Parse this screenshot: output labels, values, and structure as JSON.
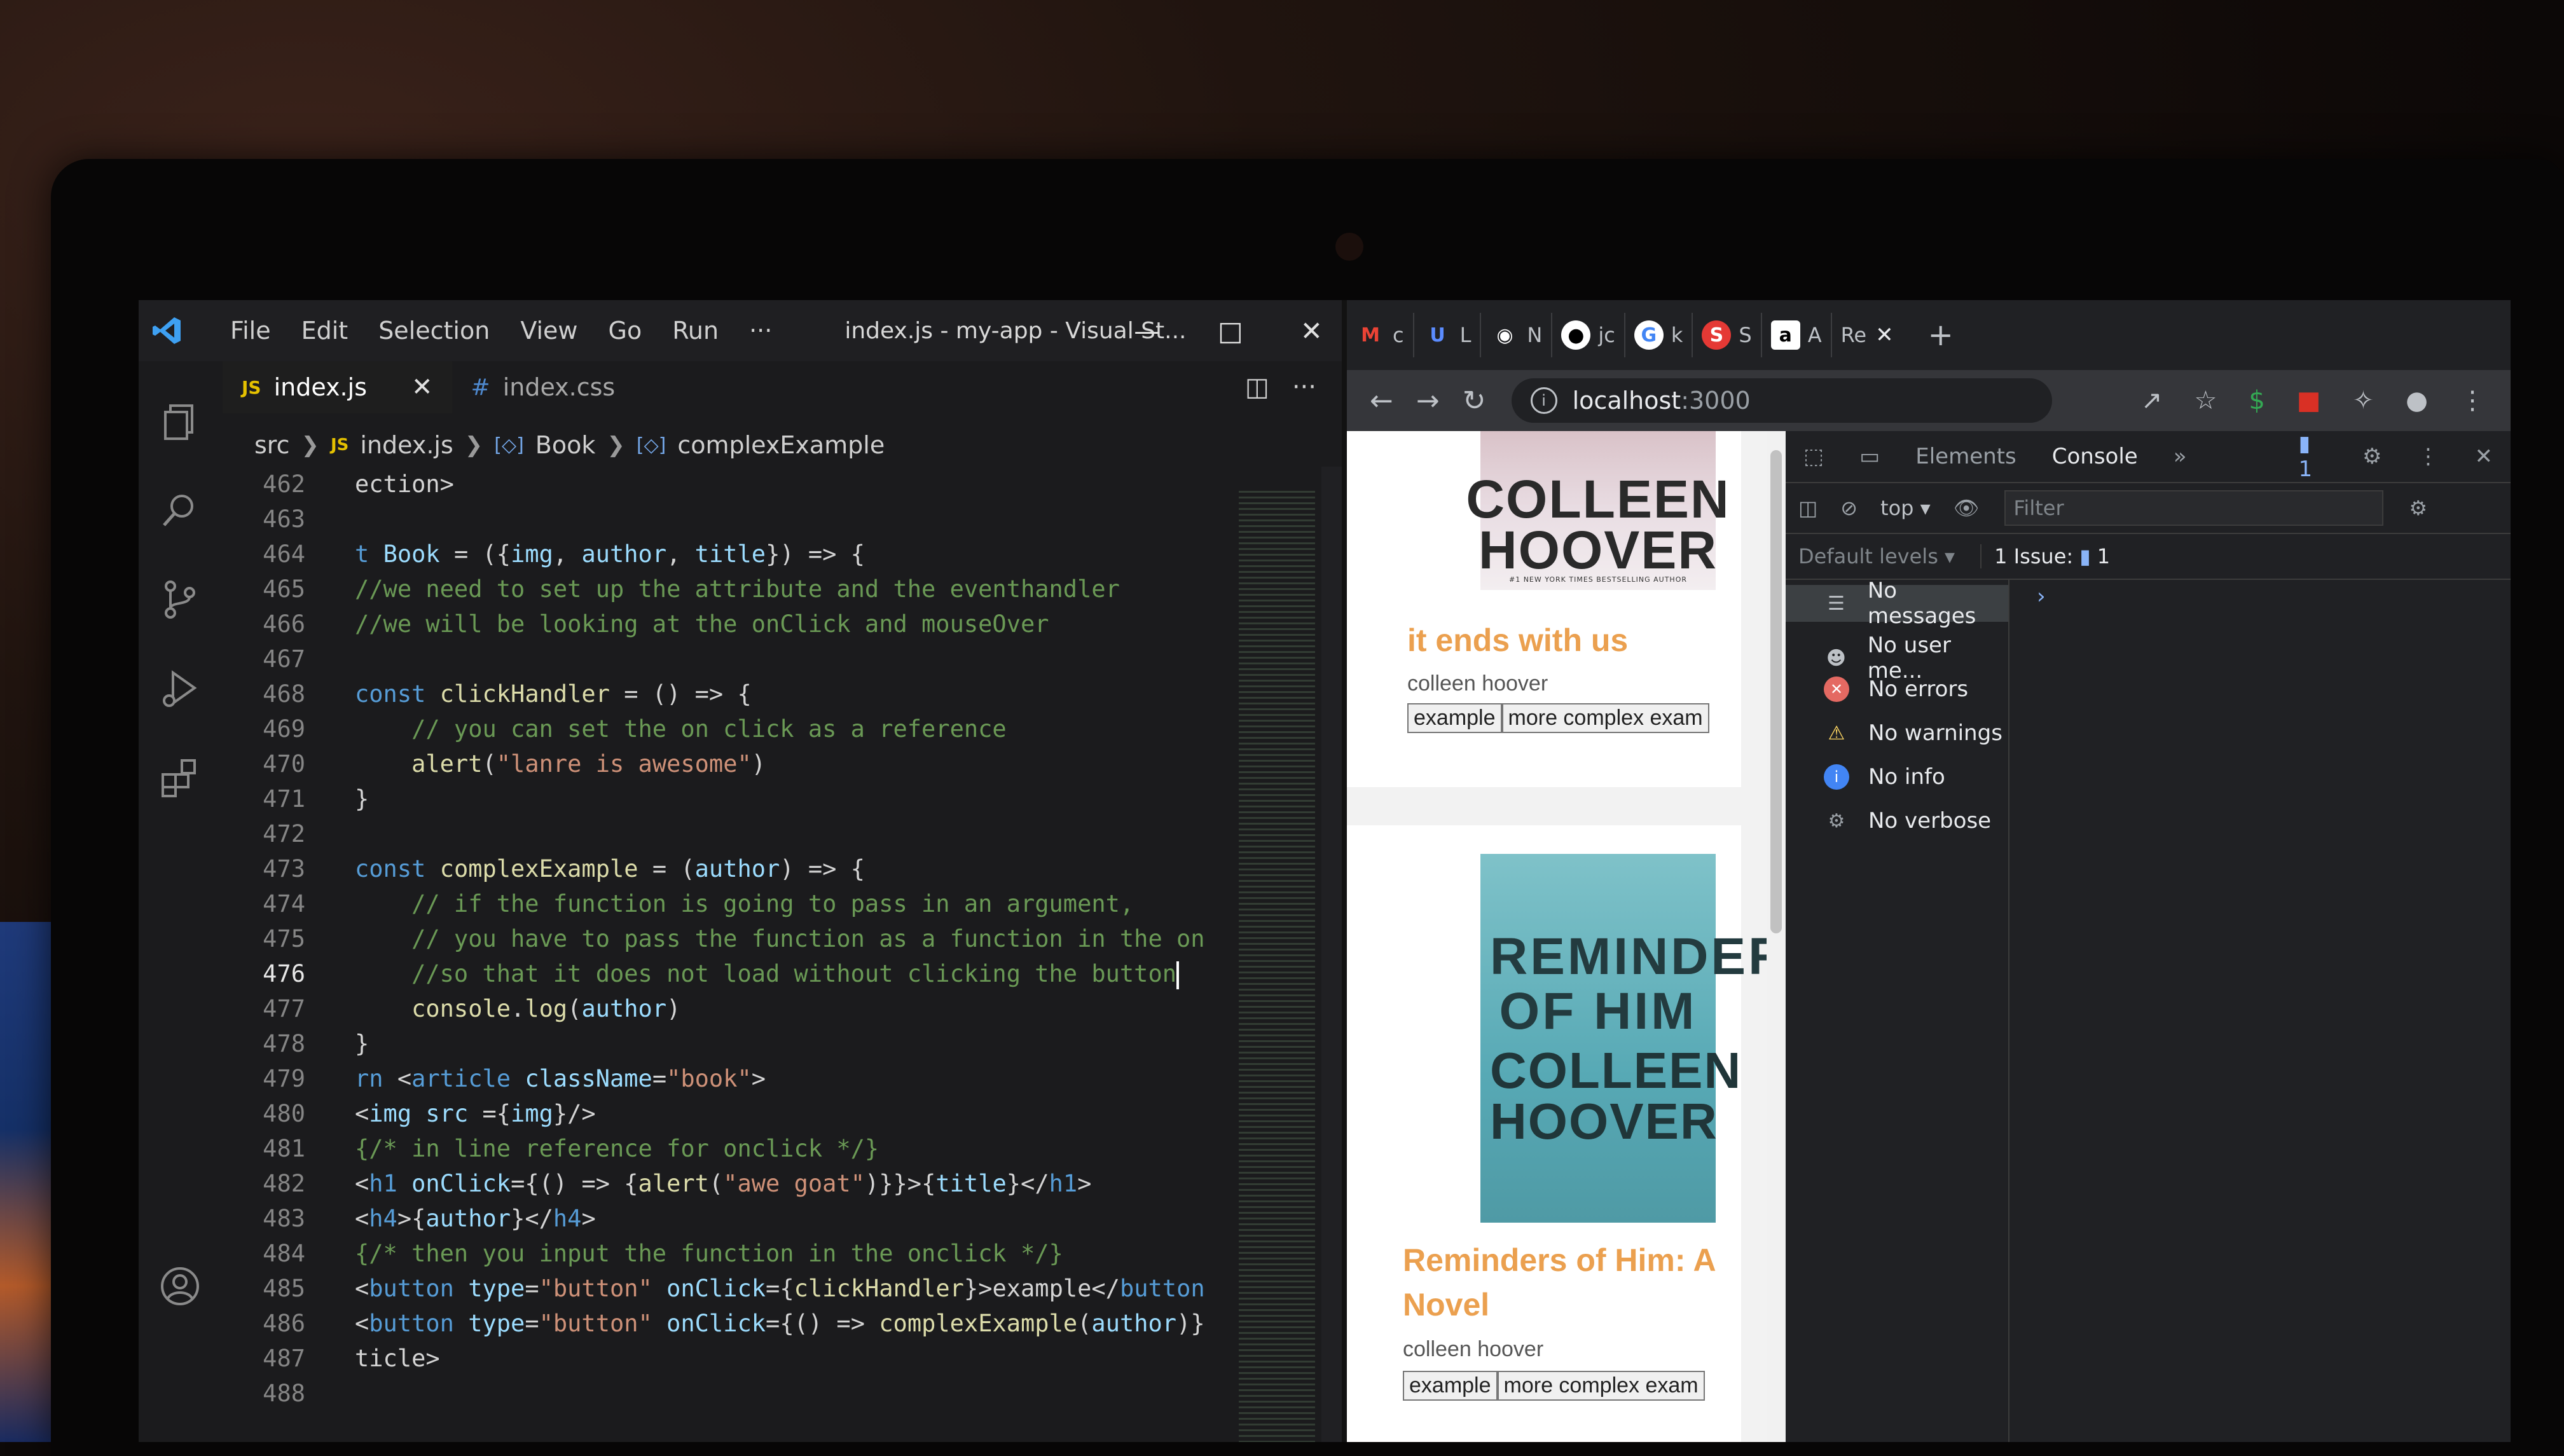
{
  "vscode": {
    "menu": [
      "File",
      "Edit",
      "Selection",
      "View",
      "Go",
      "Run",
      "···"
    ],
    "window_title": "index.js - my-app - Visual St...",
    "tabs": [
      {
        "label": "index.js",
        "active": true,
        "badge": "JS"
      },
      {
        "label": "index.css",
        "active": false,
        "badge": "#"
      }
    ],
    "breadcrumb": [
      "src",
      "index.js",
      "Book",
      "complexExample"
    ],
    "lines": [
      {
        "n": "462",
        "code": "ection>"
      },
      {
        "n": "463",
        "code": ""
      },
      {
        "n": "464",
        "code": "t Book = ({img, author, title}) => {"
      },
      {
        "n": "465",
        "code": "//we need to set up the attribute and the eventhandler"
      },
      {
        "n": "466",
        "code": "//we will be looking at the onClick and mouseOver"
      },
      {
        "n": "467",
        "code": ""
      },
      {
        "n": "468",
        "code": "const clickHandler = () => {"
      },
      {
        "n": "469",
        "code": "    // you can set the on click as a reference"
      },
      {
        "n": "470",
        "code": "    alert(\"lanre is awesome\")"
      },
      {
        "n": "471",
        "code": "}"
      },
      {
        "n": "472",
        "code": ""
      },
      {
        "n": "473",
        "code": "const complexExample = (author) => {"
      },
      {
        "n": "474",
        "code": "    // if the function is going to pass in an argument,"
      },
      {
        "n": "475",
        "code": "    // you have to pass the function as a function in the on"
      },
      {
        "n": "476",
        "code": "    //so that it does not load without clicking the button"
      },
      {
        "n": "477",
        "code": "    console.log(author)"
      },
      {
        "n": "478",
        "code": "}"
      },
      {
        "n": "479",
        "code": "rn <article className=\"book\">"
      },
      {
        "n": "480",
        "code": "<img src ={img}/>"
      },
      {
        "n": "481",
        "code": "{/* in line reference for onclick */}"
      },
      {
        "n": "482",
        "code": "<h1 onClick={() => {alert(\"awe goat\")}}>{title}</h1>"
      },
      {
        "n": "483",
        "code": "<h4>{author}</h4>"
      },
      {
        "n": "484",
        "code": "{/* then you input the function in the onclick */}"
      },
      {
        "n": "485",
        "code": "<button type=\"button\" onClick={clickHandler}>example</button"
      },
      {
        "n": "486",
        "code": "<button type=\"button\" onClick={() => complexExample(author)}"
      },
      {
        "n": "487",
        "code": "ticle>"
      },
      {
        "n": "488",
        "code": ""
      }
    ]
  },
  "chrome": {
    "tabs": [
      "c",
      "L",
      "N",
      "jc",
      "k",
      "S",
      "A",
      "Re"
    ],
    "url_host": "localhost",
    "url_port": ":3000",
    "page": {
      "book1": {
        "cover_author": "COLLEEN HOOVER",
        "cover_sub": "#1 NEW YORK TIMES BESTSELLING AUTHOR",
        "title": "it ends with us",
        "author": "colleen hoover",
        "btn1": "example",
        "btn2": "more complex exam"
      },
      "book2": {
        "cover_title": "REMINDERS OF HIM",
        "cover_author": "COLLEEN HOOVER",
        "title_line1": "Reminders of Him: A",
        "title_line2": "Novel",
        "author": "colleen hoover",
        "btn1": "example",
        "btn2": "more complex exam"
      }
    },
    "devtools": {
      "tabs": [
        "Elements",
        "Console"
      ],
      "more": "»",
      "issues_count": "1",
      "context": "top ▾",
      "filter_placeholder": "Filter",
      "levels": "Default levels ▾",
      "issue_label": "1 Issue:",
      "sidebar": [
        "No messages",
        "No user me...",
        "No errors",
        "No warnings",
        "No info",
        "No verbose"
      ]
    }
  },
  "colors": {
    "keyword": "#569cd6",
    "comment": "#6a9955",
    "string": "#ce9178",
    "book_title": "#eba04f"
  }
}
